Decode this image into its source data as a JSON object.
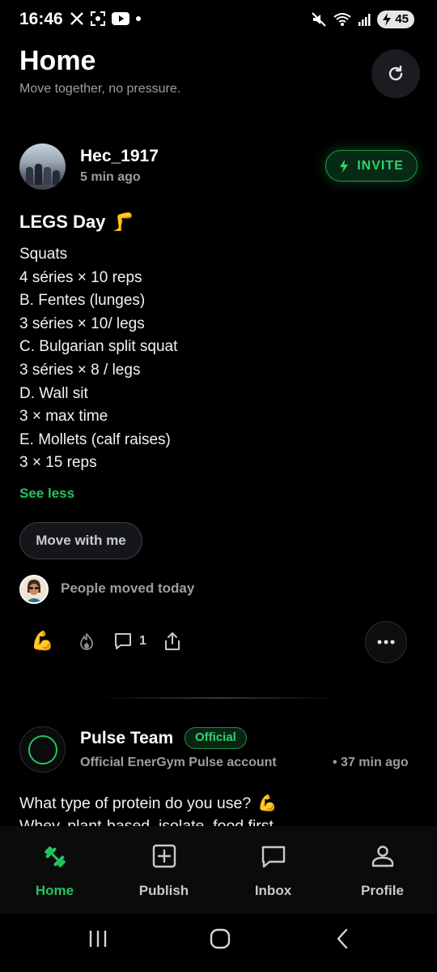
{
  "status_bar": {
    "time": "16:46",
    "battery": "45",
    "icons_left": [
      "x-icon",
      "scan-icon",
      "youtube-icon",
      "dot-icon"
    ],
    "icons_right": [
      "mute-icon",
      "wifi-icon",
      "signal-icon",
      "battery-icon"
    ]
  },
  "header": {
    "title": "Home",
    "subtitle": "Move together, no pressure."
  },
  "post1": {
    "username": "Hec_1917",
    "time": "5 min ago",
    "invite_label": "INVITE",
    "title": "LEGS Day",
    "title_emoji": "🦵",
    "body_lines": [
      "Squats",
      "4 séries × 10 reps",
      "B. Fentes (lunges)",
      "3 séries × 10/ legs",
      "C. Bulgarian split squat",
      "3 séries × 8 / legs",
      "D. Wall sit",
      "3 × max time",
      "E. Mollets (calf raises)",
      "3 × 15 reps"
    ],
    "see_less": "See less",
    "move_button": "Move with me",
    "people_moved": "People moved today",
    "reactions": {
      "flex_emoji": "💪",
      "comment_count": "1"
    }
  },
  "post2": {
    "name": "Pulse Team",
    "badge": "Official",
    "subtitle": "Official EnerGym Pulse account",
    "time": "• 37 min ago",
    "body_line1": "What type of protein do you use?",
    "body_line1_emoji": "💪",
    "body_line2": "Whey, plant-based, isolate, food first"
  },
  "bottom_nav": {
    "items": [
      {
        "label": "Home",
        "icon": "dumbbell-icon",
        "active": true
      },
      {
        "label": "Publish",
        "icon": "plus-square-icon"
      },
      {
        "label": "Inbox",
        "icon": "chat-icon"
      },
      {
        "label": "Profile",
        "icon": "person-icon"
      }
    ]
  },
  "colors": {
    "accent": "#22c55e",
    "background": "#000000",
    "muted_text": "#9a9ea6"
  }
}
